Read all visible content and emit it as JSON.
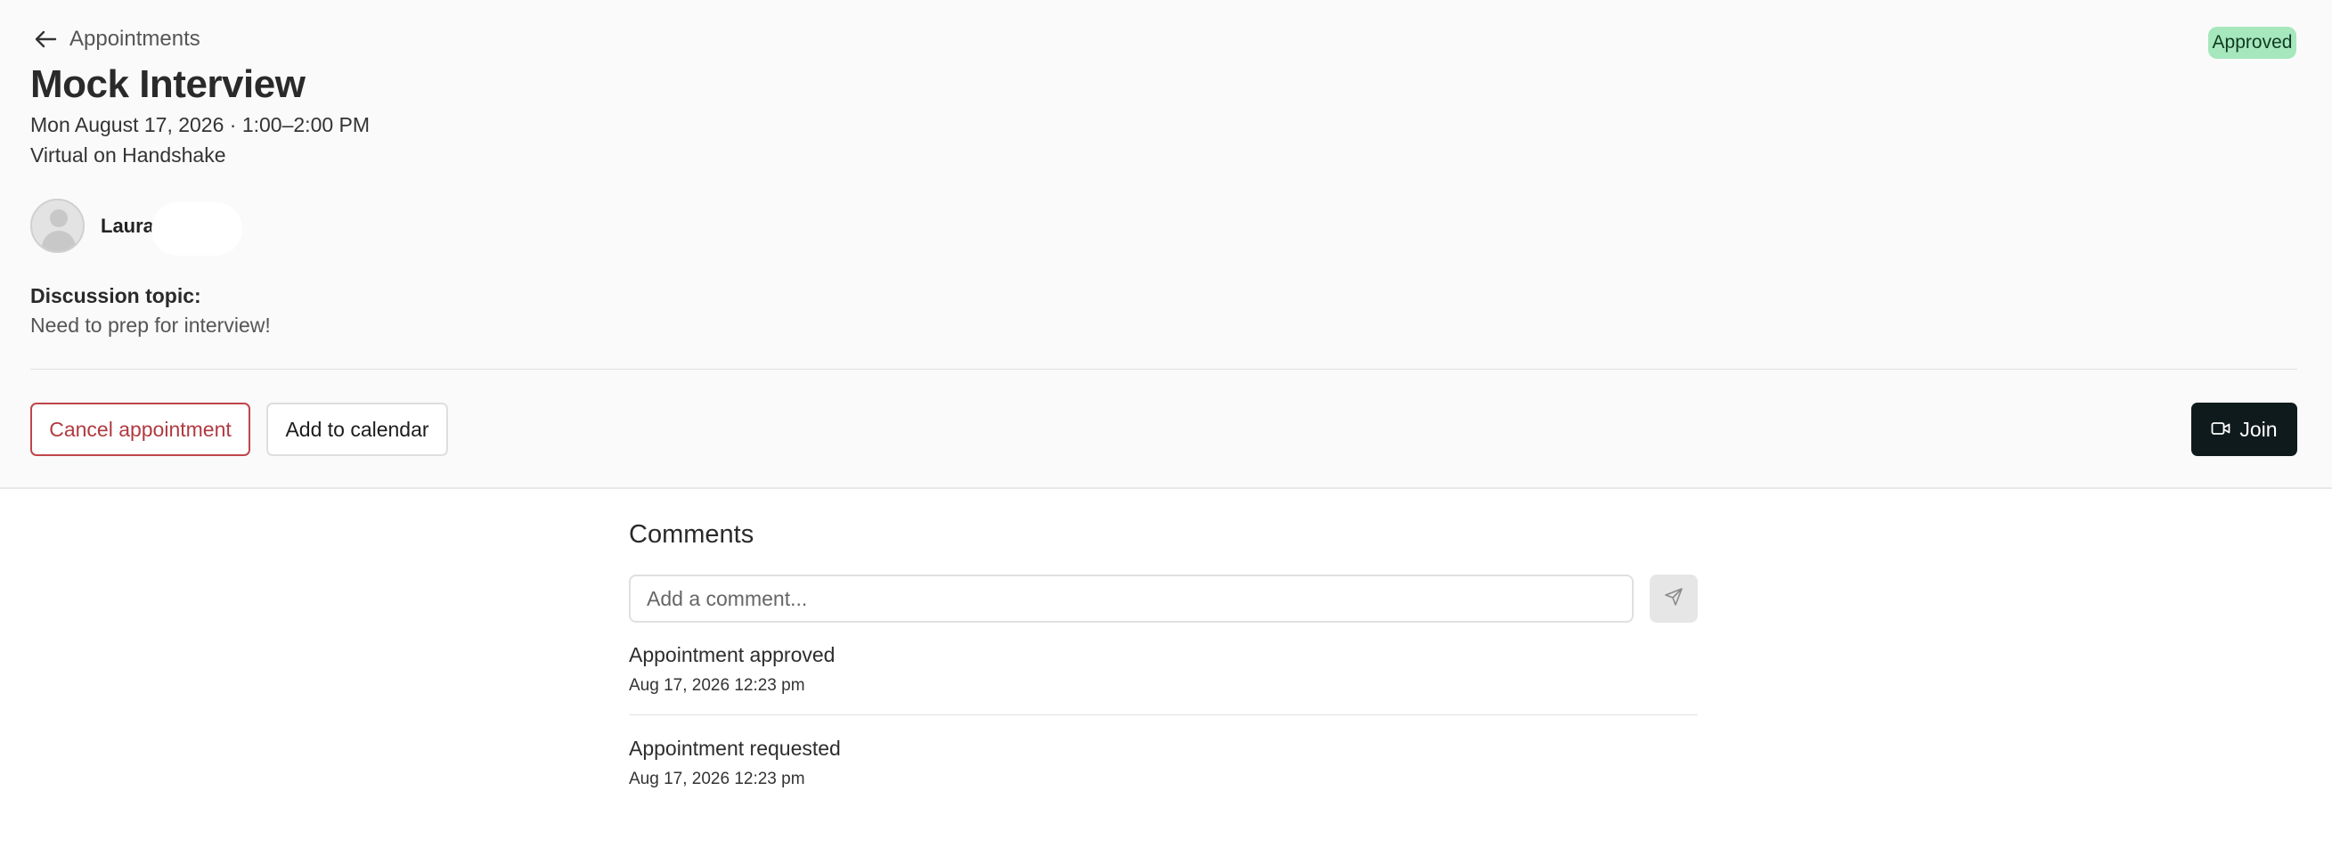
{
  "header": {
    "back_label": "Appointments",
    "status_badge": "Approved",
    "title": "Mock Interview",
    "datetime": "Mon August 17, 2026 · 1:00–2:00 PM",
    "location": "Virtual on Handshake"
  },
  "person": {
    "name": "Laura"
  },
  "discussion": {
    "label": "Discussion topic:",
    "text": "Need to prep for interview!"
  },
  "actions": {
    "cancel_label": "Cancel appointment",
    "calendar_label": "Add to calendar",
    "join_label": "Join"
  },
  "comments": {
    "title": "Comments",
    "input_placeholder": "Add a comment...",
    "input_value": "",
    "activity": [
      {
        "text": "Appointment approved",
        "time": "Aug 17, 2026 12:23 pm"
      },
      {
        "text": "Appointment requested",
        "time": "Aug 17, 2026 12:23 pm"
      }
    ]
  },
  "colors": {
    "badge_bg": "#a6e7bd",
    "cancel_red": "#b03a40",
    "join_bg": "#0f1a1c",
    "top_bg": "#fafafa"
  },
  "icons": {
    "back": "arrow-left-icon",
    "avatar": "person-placeholder-icon",
    "join": "video-camera-icon",
    "send": "send-paper-plane-icon"
  }
}
